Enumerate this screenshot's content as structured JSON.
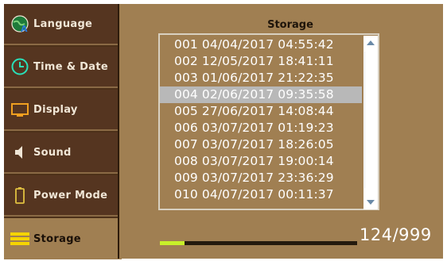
{
  "sidebar": {
    "items": [
      {
        "label": "Language",
        "icon": "globe-icon"
      },
      {
        "label": "Time & Date",
        "icon": "clock-icon"
      },
      {
        "label": "Display",
        "icon": "monitor-icon"
      },
      {
        "label": "Sound",
        "icon": "speaker-icon"
      },
      {
        "label": "Power Mode",
        "icon": "battery-icon"
      },
      {
        "label": "Storage",
        "icon": "storage-icon",
        "active": true
      }
    ]
  },
  "storage": {
    "title": "Storage",
    "selected_index": 3,
    "rows": [
      "001 04/04/2017 04:55:42",
      "002 12/05/2017 18:41:11",
      "003 01/06/2017 21:22:35",
      "004 02/06/2017 09:35:58",
      "005 27/06/2017 14:08:44",
      "006 03/07/2017 01:19:23",
      "007 03/07/2017 18:26:05",
      "008 03/07/2017 19:00:14",
      "009 03/07/2017 23:36:29",
      "010 04/07/2017 00:11:37"
    ],
    "counter": "124/999",
    "usage_fraction": 0.124
  },
  "colors": {
    "sidebar": "#553520",
    "panel": "#a07f52",
    "selected_row": "#b8b8b8",
    "progress": "#c8f02a",
    "storage_icon": "#f5d400",
    "time_icon": "#29e0b8",
    "power_icon": "#e0c040"
  }
}
